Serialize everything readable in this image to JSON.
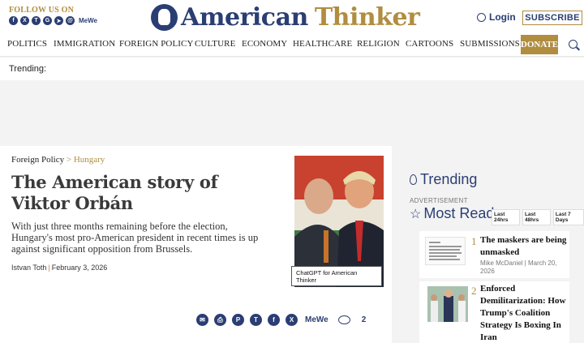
{
  "header": {
    "follow_label": "FOLLOW US ON",
    "social_icons": [
      "facebook-icon",
      "x-icon",
      "truth-social-icon",
      "gettr-icon",
      "telegram-icon",
      "email-icon"
    ],
    "mewe_label": "MeWe",
    "logo_part1": "American",
    "logo_part2": "Thinker",
    "login_label": "Login",
    "subscribe_label": "SUBSCRIBE"
  },
  "nav": {
    "items": [
      "POLITICS",
      "IMMIGRATION",
      "FOREIGN POLICY",
      "CULTURE",
      "ECONOMY",
      "HEALTHCARE",
      "RELIGION",
      "CARTOONS",
      "SUBMISSIONS"
    ],
    "donate_label": "DONATE"
  },
  "trending_bar": {
    "label": "Trending:"
  },
  "article": {
    "category": "Foreign Policy",
    "separator": ">",
    "subcategory": "Hungary",
    "title": "The American story of Viktor Orbán",
    "dek": "With just three months remaining before the election, Hungary's most pro-American president in recent times is up against significant opposition from Brussels.",
    "author": "Istvan Toth",
    "date": "February 3, 2026",
    "photo_caption": "ChatGPT for American Thinker",
    "share": {
      "mewe_label": "MeWe",
      "comment_count": "2"
    }
  },
  "sidebar": {
    "trending_title": "Trending",
    "advertisement_label": "ADVERTISEMENT",
    "most_read_title": "Most Read",
    "tabs": [
      "Last 24hrs",
      "Last 48hrs",
      "Last 7 Days"
    ],
    "items": [
      {
        "rank": "1",
        "title": "The maskers are being unmasked",
        "meta": "Mike McDaniel | March 20, 2026"
      },
      {
        "rank": "2",
        "title": "Enforced Demilitarization: How Trump's Coalition Strategy Is Boxing In Iran",
        "meta": ""
      }
    ]
  },
  "colors": {
    "navy": "#2b3e73",
    "gold": "#b08d3f"
  }
}
